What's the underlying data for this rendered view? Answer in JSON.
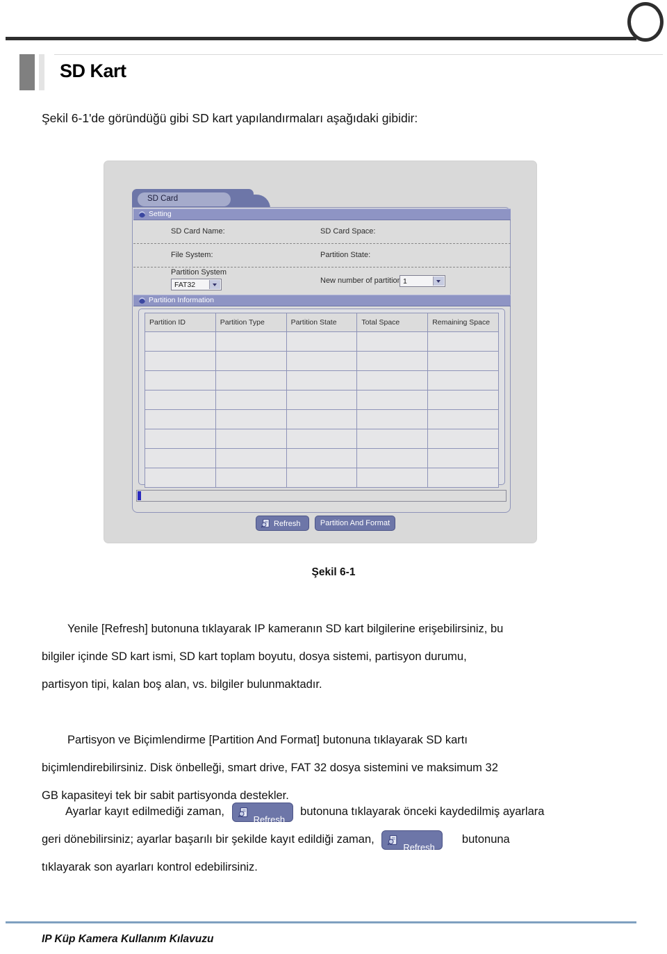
{
  "page": {
    "chapter_title": "SD Kart",
    "intro": "Şekil 6-1'de göründüğü gibi SD kart yapılandırmaları aşağıdaki gibidir:",
    "figure_caption": "Şekil 6-1",
    "footer": "IP Küp Kamera Kullanım Kılavuzu"
  },
  "figure": {
    "tab": {
      "label": "SD Card"
    },
    "sections": {
      "setting": {
        "label": "Setting",
        "icon": "circle-bullet-icon"
      },
      "partition_information": {
        "label": "Partition Information",
        "icon": "circle-bullet-icon"
      }
    },
    "fields": {
      "sd_card_name_label": "SD Card Name:",
      "sd_card_space_label": "SD Card Space:",
      "file_system_label": "File System:",
      "partition_state_label": "Partition State:",
      "partition_system_label": "Partition System",
      "partition_system_value": "FAT32",
      "new_number_of_partition_label": "New number of partition",
      "new_number_of_partition_value": "1"
    },
    "table": {
      "columns": [
        "Partition ID",
        "Partition Type",
        "Partition State",
        "Total Space",
        "Remaining Space"
      ],
      "rows": [
        [
          "",
          "",
          "",
          "",
          ""
        ],
        [
          "",
          "",
          "",
          "",
          ""
        ],
        [
          "",
          "",
          "",
          "",
          ""
        ],
        [
          "",
          "",
          "",
          "",
          ""
        ],
        [
          "",
          "",
          "",
          "",
          ""
        ],
        [
          "",
          "",
          "",
          "",
          ""
        ],
        [
          "",
          "",
          "",
          "",
          ""
        ],
        [
          "",
          "",
          "",
          "",
          ""
        ]
      ]
    },
    "status_bar": {
      "text": ""
    },
    "buttons": {
      "refresh": "Refresh",
      "partition_and_format": "Partition And Format"
    },
    "colors": {
      "panel_bg": "#dcdcdc",
      "section_bar": "#8e94c4",
      "tab_strip": "#6d76a8",
      "tab_pill": "#a5abcb",
      "button_bg": "#6d76a8",
      "table_border": "#8e93b8",
      "status_caret": "#2b2bbe"
    }
  },
  "body": {
    "paragraph_1": {
      "lines": [
        "Yenile [Refresh] butonuna tıklayarak IP kameranın SD kart bilgilerine erişebilirsiniz, bu",
        "bilgiler içinde SD kart ismi, SD kart toplam boyutu, dosya sistemi, partisyon durumu,",
        "partisyon tipi, kalan boş alan, vs. bilgiler bulunmaktadır."
      ]
    },
    "paragraph_2": {
      "lines": [
        "Partisyon ve Biçimlendirme [Partition And Format] butonuna tıklayarak SD kartı",
        "biçimlendirebilirsiniz. Disk önbelleği, smart drive, FAT 32 dosya sistemini ve maksimum 32",
        "GB kapasiteyi tek bir sabit partisyonda destekler."
      ]
    },
    "paragraph_3": {
      "line1_before": "Ayarlar kayıt edilmediği zaman,",
      "inline_button_1": "Refresh",
      "line1_after": "butonuna tıklayarak önceki kaydedilmiş ayarlara",
      "line2_before": "geri   dönebilirsiniz;   ayarlar   başarılı   bir   şekilde   kayıt   edildiği   zaman,",
      "inline_button_2": "Refresh",
      "line2_after": "butonuna",
      "line3": "tıklayarak son ayarları kontrol edebilirsiniz."
    }
  }
}
